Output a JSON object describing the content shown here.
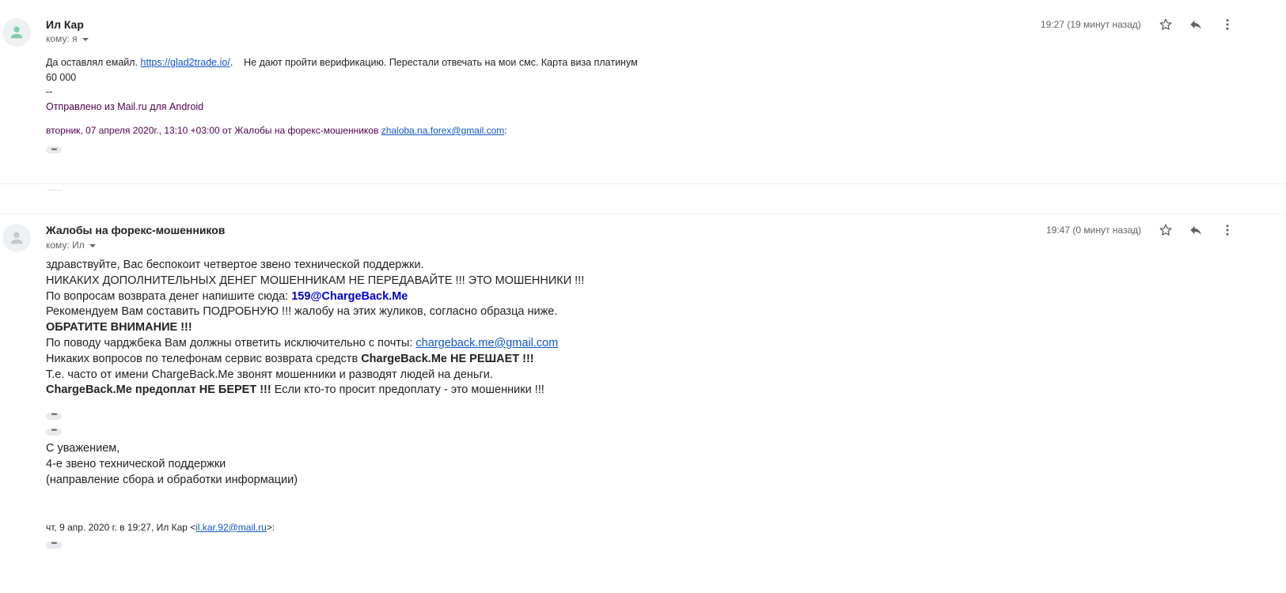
{
  "message1": {
    "sender": "Ил Кар",
    "recipient": "кому: я",
    "time": "19:27 (19 минут назад)",
    "body_prefix": "Да оставлял емайл. ",
    "link": "https://glad2trade.io/",
    "body_rest": ".    Не дают пройти верификацию. Перестали отвечать на мои смс. Карта виза платинум",
    "amount": "60 000",
    "sig_dash": "--",
    "sent_from": "Отправлено из Mail.ru для Android",
    "quote_header_prefix": "вторник, 07 апреля 2020г., 13:10 +03:00 от Жалобы на форекс-мошенников ",
    "quote_email": "zhaloba.na.forex@gmail.com",
    "quote_header_suffix": ":"
  },
  "message2": {
    "sender": "Жалобы на форекс-мошенников",
    "recipient": "кому: Ил",
    "time": "19:47 (0 минут назад)",
    "line1": "здравствуйте, Вас беспокоит четвертое звено технической поддержки.",
    "line2": "НИКАКИХ ДОПОЛНИТЕЛЬНЫХ ДЕНЕГ МОШЕННИКАМ НЕ ПЕРЕДАВАЙТЕ !!! ЭТО МОШЕННИКИ !!!",
    "line3_prefix": "По вопросам возврата денег напишите сюда: ",
    "line3_email": "159@ChargeBack.Me",
    "line4": "Рекомендуем Вам составить ПОДРОБНУЮ !!! жалобу на этих жуликов, согласно образца ниже.",
    "line5": "ОБРАТИТЕ ВНИМАНИЕ !!!",
    "line6_prefix": "По поводу чарджбека Вам должны ответить исключительно с почты: ",
    "line6_email": "chargeback.me@gmail.com",
    "line7_prefix": "Никаких вопросов по телефонам сервис возврата средств ",
    "line7_bold": "ChargeBack.Me НЕ РЕШАЕТ !!!",
    "line8": "Т.е. часто от имени ChargeBack.Me звонят мошенники и разводят людей на деньги.",
    "line9_bold": "ChargeBack.Me предоплат НЕ БЕРЕТ !!!",
    "line9_rest": " Если кто-то просит предоплату - это мошенники !!!",
    "sig1": "С уважением,",
    "sig2": "4-е звено технической поддержки",
    "sig3": "(направление сбора и обработки информации)",
    "quote_prefix": "чт, 9 апр. 2020 г. в 19:27, Ил Кар <",
    "quote_email": "il.kar.92@mail.ru",
    "quote_suffix": ">:"
  },
  "icons": {
    "avatar": "person-icon",
    "star": "star-icon",
    "reply": "reply-icon",
    "more": "more-vert-icon",
    "expand": "show-trimmed-icon"
  },
  "colors": {
    "link": "#1155cc",
    "sent_from": "#500050",
    "email_highlight": "#0000cc"
  }
}
